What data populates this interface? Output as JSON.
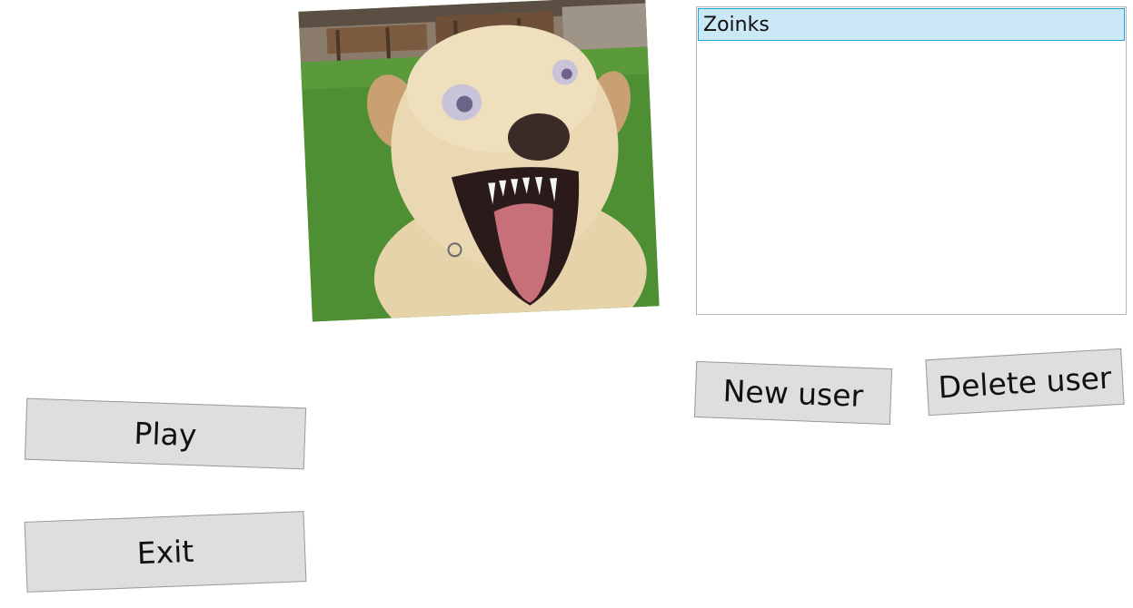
{
  "picture": {
    "icon": "dog-photo",
    "colors": {
      "grass": "#4f8f33",
      "fur": "#e9d6ad",
      "background": "#8a7b6a"
    }
  },
  "user_list": {
    "items": [
      {
        "label": "Zoinks",
        "selected": true
      }
    ],
    "colors": {
      "selection": "#cbe8f6",
      "selection_border": "#26a0da"
    }
  },
  "buttons": {
    "play": "Play",
    "exit": "Exit",
    "new_user": "New user",
    "delete_user": "Delete user"
  },
  "colors": {
    "button_face": "#dedede",
    "button_border": "#9a9a9a"
  }
}
